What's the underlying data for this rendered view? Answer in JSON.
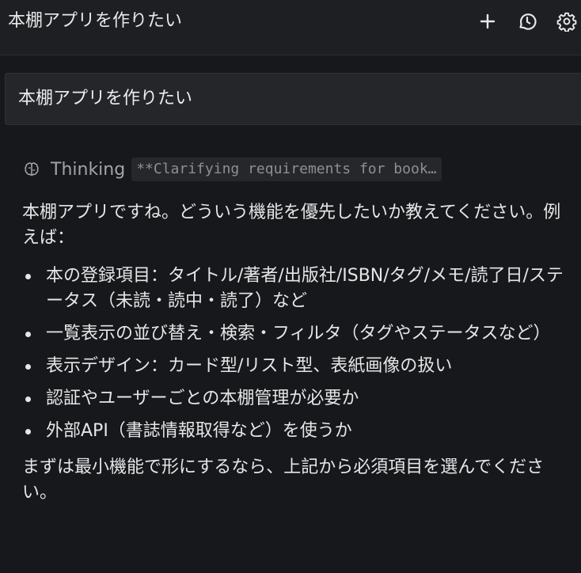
{
  "header": {
    "title": "本棚アプリを作りたい",
    "icons": [
      "plus-icon",
      "history-icon",
      "gear-icon"
    ]
  },
  "user_message": {
    "text": "本棚アプリを作りたい"
  },
  "thinking": {
    "label": "Thinking",
    "summary": "**Clarifying requirements for book…"
  },
  "response": {
    "intro": "本棚アプリですね。どういう機能を優先したいか教えてください。例えば：",
    "items": [
      "本の登録項目：タイトル/著者/出版社/ISBN/タグ/メモ/読了日/ステータス（未読・読中・読了）など",
      "一覧表示の並び替え・検索・フィルタ（タグやステータスなど）",
      "表示デザイン：カード型/リスト型、表紙画像の扱い",
      "認証やユーザーごとの本棚管理が必要か",
      "外部API（書誌情報取得など）を使うか"
    ],
    "closing": "まずは最小機能で形にするなら、上記から必須項目を選んでください。"
  },
  "colors": {
    "background": "#17181b",
    "header_background": "#1e1f22",
    "user_message_background": "#25262a",
    "text": "#e6e6e6",
    "muted_text": "#a3a4a8"
  }
}
